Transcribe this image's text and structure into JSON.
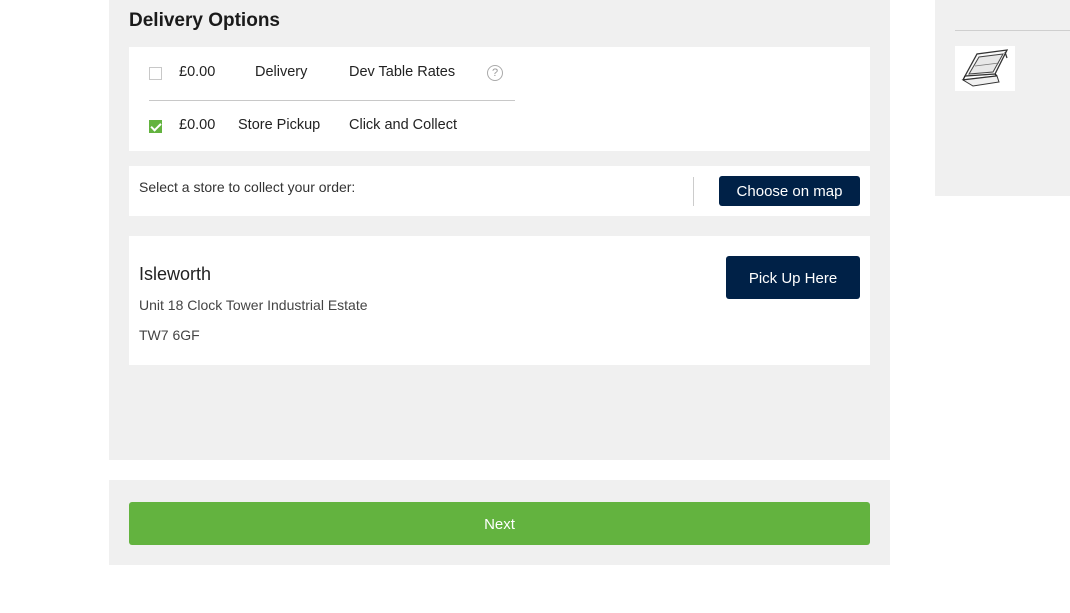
{
  "delivery": {
    "title": "Delivery Options",
    "options": [
      {
        "checked": false,
        "price": "£0.00",
        "method": "Delivery",
        "carrier": "Dev Table Rates",
        "help_icon": "?"
      },
      {
        "checked": true,
        "price": "£0.00",
        "method": "Store Pickup",
        "carrier": "Click and Collect"
      }
    ]
  },
  "store_selector": {
    "prompt": "Select a store to collect your order:",
    "map_button": "Choose on map"
  },
  "store": {
    "name": "Isleworth",
    "address_line": "Unit 18 Clock Tower Industrial Estate",
    "postcode": "TW7 6GF",
    "pick_button": "Pick Up Here"
  },
  "next_button": "Next",
  "sidebar": {
    "thumbnail_icon": "roof-window-product-image"
  },
  "colors": {
    "accent_green": "#63b33f",
    "button_navy": "#002147",
    "panel_gray": "#f0f0f0"
  }
}
